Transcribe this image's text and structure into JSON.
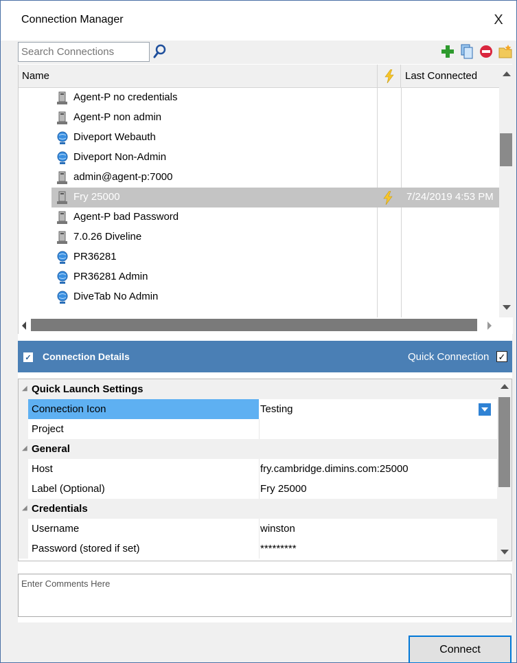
{
  "window": {
    "title": "Connection Manager",
    "close_glyph": "X"
  },
  "search": {
    "placeholder": "Search Connections",
    "value": ""
  },
  "toolbar": {
    "icons": [
      "add-icon",
      "copy-icon",
      "delete-icon",
      "new-folder-icon"
    ]
  },
  "grid": {
    "columns": {
      "name": "Name",
      "last_connected": "Last Connected"
    },
    "rows": [
      {
        "label": "Agent-P no credentials",
        "icon": "server-icon"
      },
      {
        "label": "Agent-P non admin",
        "icon": "server-icon"
      },
      {
        "label": "Diveport Webauth",
        "icon": "globe-icon"
      },
      {
        "label": "Diveport Non-Admin",
        "icon": "globe-icon"
      },
      {
        "label": "admin@agent-p:7000",
        "icon": "server-icon"
      },
      {
        "label": "Fry 25000",
        "icon": "server-icon",
        "selected": true,
        "last_connected": "7/24/2019 4:53 PM"
      },
      {
        "label": "Agent-P bad Password",
        "icon": "server-icon"
      },
      {
        "label": "7.0.26 Diveline",
        "icon": "server-icon"
      },
      {
        "label": "PR36281",
        "icon": "globe-icon"
      },
      {
        "label": "PR36281 Admin",
        "icon": "globe-icon"
      },
      {
        "label": "DiveTab No Admin",
        "icon": "globe-icon"
      }
    ]
  },
  "details": {
    "title": "Connection Details",
    "quick_connection_label": "Quick Connection",
    "quick_connection_checked": true,
    "categories": {
      "quick_launch": "Quick Launch Settings",
      "general": "General",
      "credentials": "Credentials"
    },
    "properties": {
      "connection_icon": {
        "name": "Connection Icon",
        "value": "Testing"
      },
      "project": {
        "name": "Project",
        "value": ""
      },
      "host": {
        "name": "Host",
        "value": "fry.cambridge.dimins.com:25000"
      },
      "label": {
        "name": "Label (Optional)",
        "value": "Fry 25000"
      },
      "username": {
        "name": "Username",
        "value": "winston"
      },
      "password": {
        "name": "Password (stored if set)",
        "value": "*********"
      }
    }
  },
  "comments": {
    "placeholder": "Enter Comments Here"
  },
  "footer": {
    "connect_label": "Connect"
  },
  "colors": {
    "details_bar": "#4a7fb5",
    "selected_row": "#c4c4c4",
    "highlight_property": "#5eb0f2",
    "accent": "#0078d7"
  }
}
